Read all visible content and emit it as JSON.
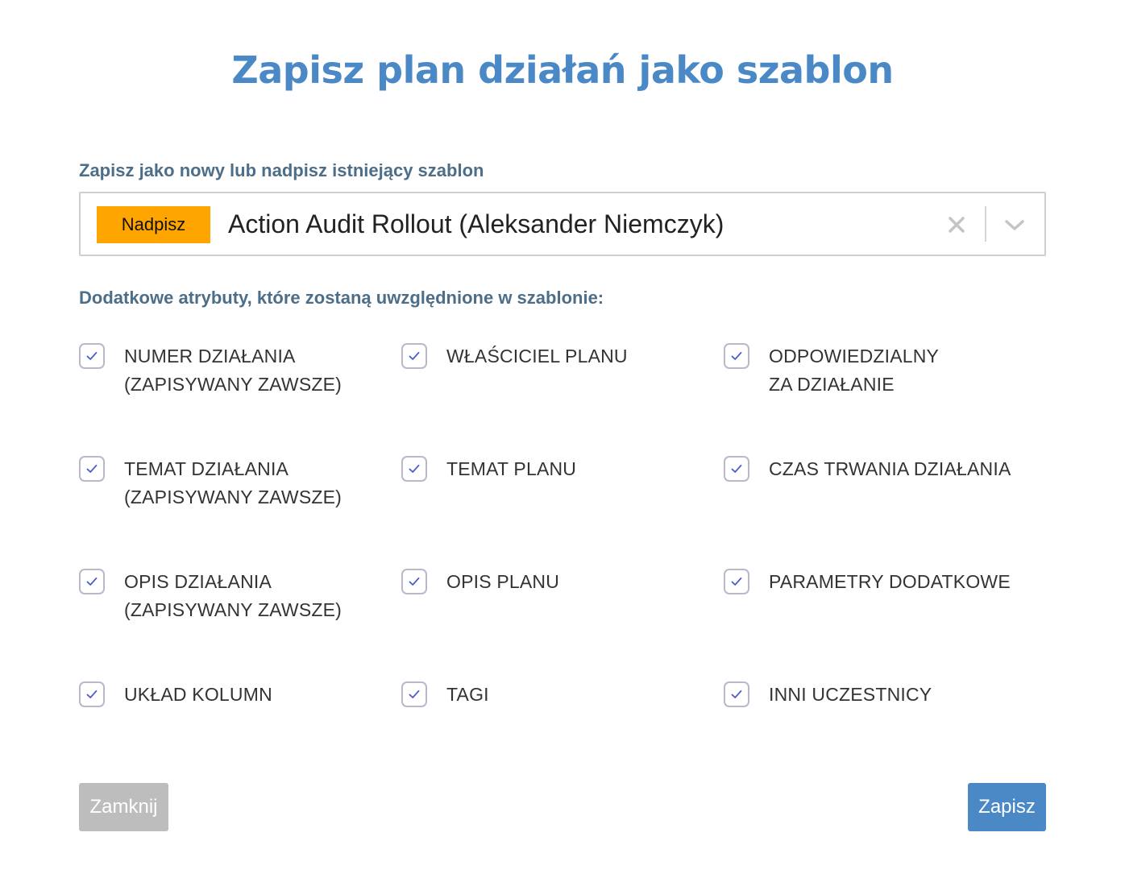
{
  "dialog": {
    "title": "Zapisz plan działań jako szablon"
  },
  "template_select": {
    "label": "Zapisz jako nowy lub nadpisz istniejący szablon",
    "badge": "Nadpisz",
    "value": "Action Audit Rollout (Aleksander Niemczyk)",
    "badge_color": "#ffa500",
    "clear_icon": "close-icon",
    "dropdown_icon": "chevron-down-icon"
  },
  "attributes": {
    "label": "Dodatkowe atrybuty, które zostaną uwzględnione w szablonie:",
    "items": [
      {
        "line1": "NUMER DZIAŁANIA",
        "line2": "(ZAPISYWANY ZAWSZE)",
        "checked": true
      },
      {
        "line1": "WŁAŚCICIEL PLANU",
        "line2": "",
        "checked": true
      },
      {
        "line1": "ODPOWIEDZIALNY",
        "line2": "ZA DZIAŁANIE",
        "checked": true
      },
      {
        "line1": "TEMAT DZIAŁANIA",
        "line2": "(ZAPISYWANY ZAWSZE)",
        "checked": true
      },
      {
        "line1": "TEMAT PLANU",
        "line2": "",
        "checked": true
      },
      {
        "line1": "CZAS TRWANIA DZIAŁANIA",
        "line2": "",
        "checked": true
      },
      {
        "line1": "OPIS DZIAŁANIA",
        "line2": "(ZAPISYWANY ZAWSZE)",
        "checked": true
      },
      {
        "line1": "OPIS PLANU",
        "line2": "",
        "checked": true
      },
      {
        "line1": "PARAMETRY DODATKOWE",
        "line2": "",
        "checked": true
      },
      {
        "line1": "UKŁAD KOLUMN",
        "line2": "",
        "checked": true
      },
      {
        "line1": "TAGI",
        "line2": "",
        "checked": true
      },
      {
        "line1": "INNI UCZESTNICY",
        "line2": "",
        "checked": true
      }
    ]
  },
  "buttons": {
    "close_label": "Zamknij",
    "save_label": "Zapisz"
  },
  "colors": {
    "accent": "#4a89c5",
    "check": "#4a5bd0",
    "disabled": "#bdbdbd"
  }
}
